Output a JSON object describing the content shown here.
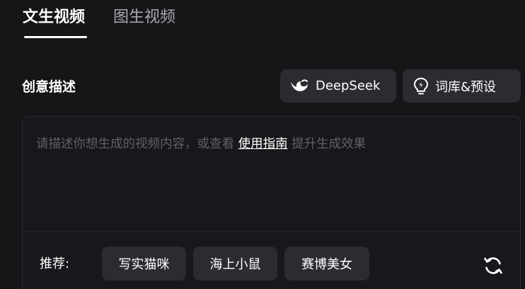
{
  "tabs": [
    {
      "label": "文生视频",
      "active": true
    },
    {
      "label": "图生视频",
      "active": false
    }
  ],
  "section": {
    "title": "创意描述"
  },
  "toolbar": {
    "deepseek_label": "DeepSeek",
    "library_label": "词库&预设",
    "deepseek_icon": "deepseek-whale-icon",
    "library_icon": "lightbulb-icon"
  },
  "prompt": {
    "placeholder_before": "请描述你想生成的视频内容，或查看",
    "link_text": "使用指南",
    "placeholder_after": "提升生成效果"
  },
  "recommend": {
    "label": "推荐:",
    "chips": [
      "写实猫咪",
      "海上小鼠",
      "赛博美女"
    ],
    "refresh_icon": "refresh-icon"
  },
  "colors": {
    "background": "#151618",
    "button_bg": "#2a2c30",
    "placeholder": "#5f6166",
    "inactive_tab": "#a7a9ad"
  }
}
